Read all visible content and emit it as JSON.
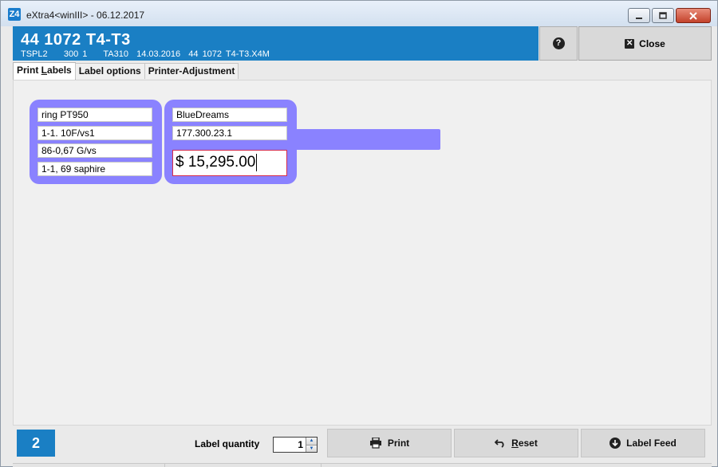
{
  "window": {
    "title": "eXtra4<winIII> - 06.12.2017",
    "app_icon": "Z4",
    "controls": [
      "minimize-icon",
      "maximize-icon",
      "close-icon"
    ]
  },
  "header": {
    "title": "44 1072 T4-T3",
    "subtitle": "TSPL2    300 1    TA310  14.03.2016  44 1072 T4-T3.X4M",
    "help_glyph": "?",
    "close_label": "Close",
    "accent_color": "#1a7fc4"
  },
  "tabs": [
    {
      "label_pre": "Print ",
      "label_ul": "L",
      "label_post": "abels",
      "active": true
    },
    {
      "label": "Label options",
      "active": false
    },
    {
      "label": "Printer-Adjustment",
      "active": false
    }
  ],
  "label_preview": {
    "background_color": "#8a82ff",
    "left_fields": [
      "ring PT950",
      "1-1. 10F/vs1",
      "86-0,67 G/vs",
      "1-1, 69 saphire"
    ],
    "right_fields": [
      "BlueDreams",
      "177.300.23.1"
    ],
    "price": "$ 15,295.00"
  },
  "footer": {
    "page_number": "2",
    "quantity_label": "Label quantity",
    "quantity_value": "1",
    "print_label": "Print",
    "reset_pre": "",
    "reset_ul": "R",
    "reset_post": "eset",
    "label_feed_label": "Label Feed"
  }
}
